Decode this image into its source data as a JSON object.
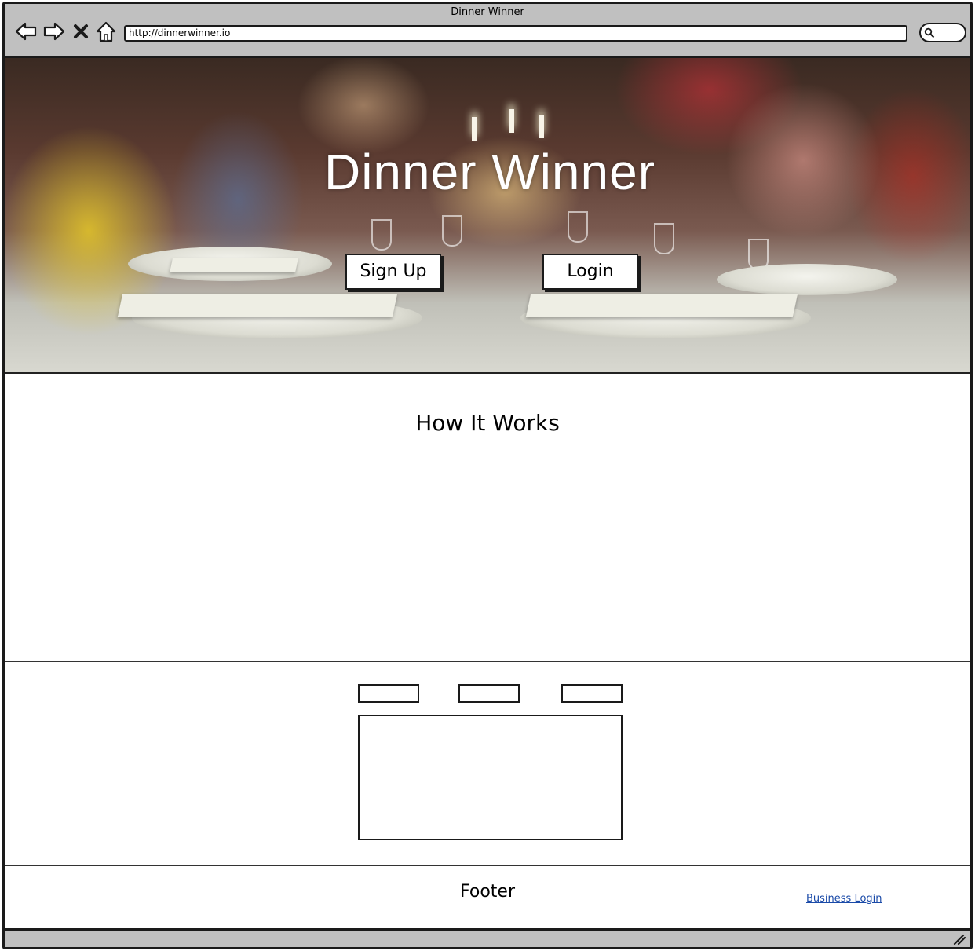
{
  "window": {
    "title": "Dinner Winner"
  },
  "browser": {
    "url": "http://dinnerwinner.io",
    "icons": [
      "back-arrow-icon",
      "forward-arrow-icon",
      "close-x-icon",
      "home-icon",
      "search-icon"
    ]
  },
  "hero": {
    "title": "Dinner Winner",
    "signup_label": "Sign Up",
    "login_label": "Login"
  },
  "how_it_works": {
    "title": "How It Works"
  },
  "tabs": {
    "count": 3
  },
  "footer": {
    "title": "Footer",
    "business_login": "Business Login"
  },
  "colors": {
    "chrome": "#c0c0c0",
    "link": "#1a4aa8",
    "outline": "#1a1a1a"
  }
}
